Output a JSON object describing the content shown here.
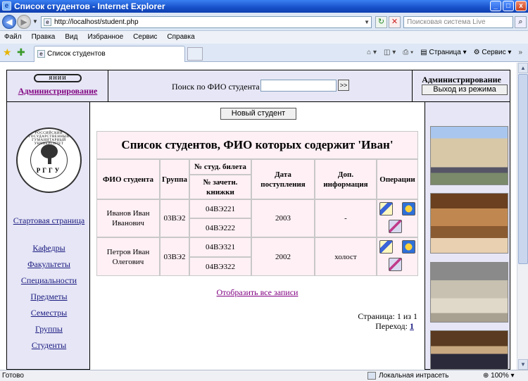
{
  "window": {
    "title": "Список студентов - Internet Explorer",
    "controls": [
      "_",
      "□",
      "x"
    ]
  },
  "addressbar": {
    "back": "◀",
    "forward": "▶",
    "url": "http://localhost/student.php",
    "search_placeholder": "Поисковая система Live"
  },
  "menu": [
    "Файл",
    "Правка",
    "Вид",
    "Избранное",
    "Сервис",
    "Справка"
  ],
  "tab": {
    "label": "Список студентов"
  },
  "tools": {
    "page": "Страница",
    "service": "Сервис"
  },
  "header": {
    "logo_text": "ЯНИИ",
    "admin_link": "Администрирование",
    "search_label": "Поиск по ФИО студента",
    "search_go": ">>",
    "admin_title": "Администрирование",
    "exit_button": "Выход из режима"
  },
  "seal": {
    "ring_text": "РОССИЙСКИЙ ГОСУДАРСТВЕННЫЙ ГУМАНИТАРНЫЙ УНИВЕРСИТЕТ",
    "letters": "РГГУ"
  },
  "nav": {
    "home": "Стартовая страница",
    "items": [
      "Кафедры",
      "Факультеты",
      "Специальности",
      "Предметы",
      "Семестры",
      "Группы",
      "Студенты"
    ]
  },
  "main": {
    "new_student_button": "Новый студент",
    "table_title": "Список студентов, ФИО которых содержит 'Иван'",
    "headers": {
      "name": "ФИО студента",
      "group": "Группа",
      "card": "№ студ. билета",
      "book": "№ зачетн. книжки",
      "date": "Дата поступления",
      "info": "Доп. информация",
      "ops": "Операции"
    },
    "rows": [
      {
        "name": "Иванов Иван Иванович",
        "group": "03ВЭ2",
        "card": "04ВЭ221",
        "book": "04ВЭ222",
        "date": "2003",
        "info": "-"
      },
      {
        "name": "Петров Иван Олегович",
        "group": "03ВЭ2",
        "card": "04ВЭ321",
        "book": "04ВЭ322",
        "date": "2002",
        "info": "холост"
      }
    ],
    "show_all": "Отобразить все записи",
    "page_info": "Страница: 1 из 1",
    "goto_label": "Переход:",
    "goto_page": "1"
  },
  "status": {
    "left": "Готово",
    "zone": "Локальная интрасеть",
    "zoom": "100%"
  }
}
